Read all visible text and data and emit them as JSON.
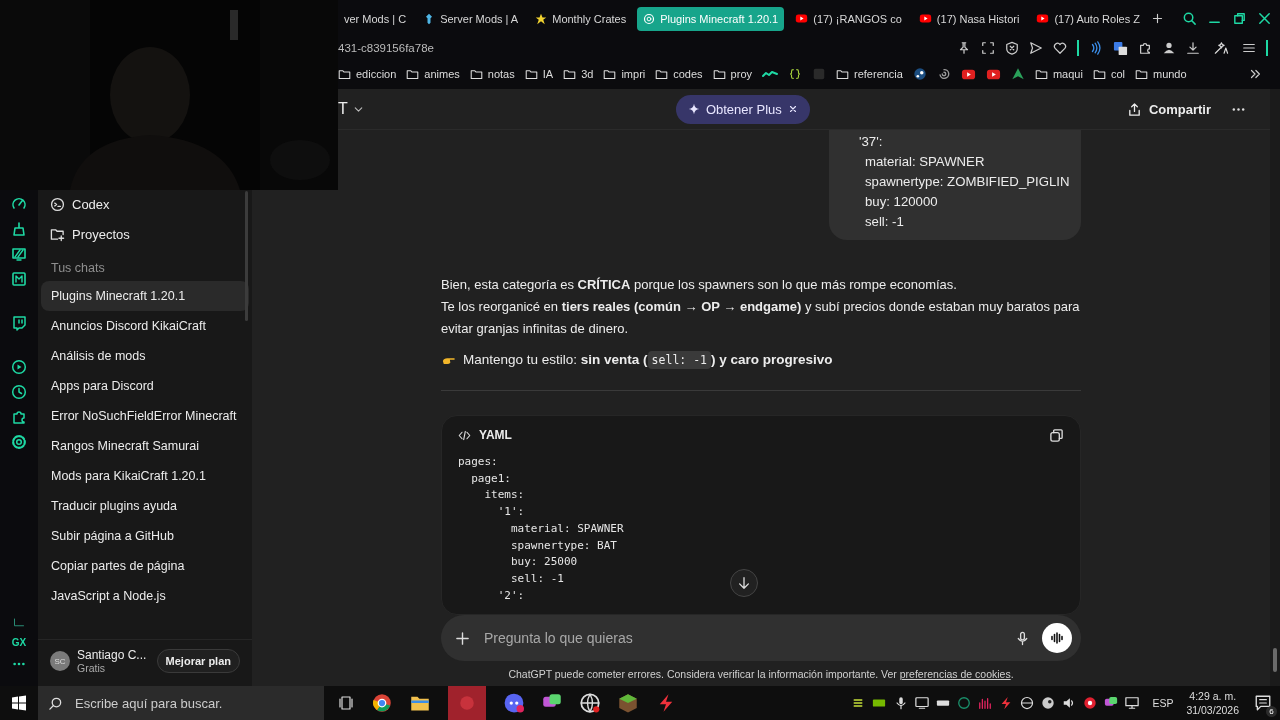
{
  "browser": {
    "tabs": [
      {
        "label": "ver Mods | C",
        "selected": false,
        "kind": "plain"
      },
      {
        "label": "Server Mods | A",
        "selected": false,
        "kind": "pin"
      },
      {
        "label": "Monthly Crates",
        "selected": false,
        "kind": "star"
      },
      {
        "label": "Plugins Minecraft 1.20.1",
        "selected": true,
        "kind": "chat"
      },
      {
        "label": "(17) ¡RANGOS co",
        "selected": false,
        "kind": "video"
      },
      {
        "label": "(17) Nasa Histori",
        "selected": false,
        "kind": "video"
      },
      {
        "label": "(17) Auto Roles Z",
        "selected": false,
        "kind": "video"
      }
    ],
    "address": "431-c839156fa78e",
    "bookmarks": [
      {
        "kind": "folder",
        "label": "ediccion"
      },
      {
        "kind": "folder",
        "label": "animes"
      },
      {
        "kind": "folder",
        "label": "notas"
      },
      {
        "kind": "folder",
        "label": "IA"
      },
      {
        "kind": "folder",
        "label": "3d"
      },
      {
        "kind": "folder",
        "label": "impri"
      },
      {
        "kind": "folder",
        "label": "codes"
      },
      {
        "kind": "folder",
        "label": "proy"
      },
      {
        "kind": "wave"
      },
      {
        "kind": "braces"
      },
      {
        "kind": "square"
      },
      {
        "kind": "folder",
        "label": "referencia"
      },
      {
        "kind": "steam"
      },
      {
        "kind": "swirl"
      },
      {
        "kind": "video"
      },
      {
        "kind": "video"
      },
      {
        "kind": "triangle"
      },
      {
        "kind": "folder",
        "label": "maqui"
      },
      {
        "kind": "folder",
        "label": "col"
      },
      {
        "kind": "folder",
        "label": "mundo"
      }
    ]
  },
  "gx_label": "GX",
  "chat_sidebar": {
    "nav": [
      {
        "label": "Codex",
        "kind": "codex"
      },
      {
        "label": "Proyectos",
        "kind": "projects"
      }
    ],
    "section": "Tus chats",
    "chats": [
      {
        "label": "Plugins Minecraft 1.20.1",
        "selected": true
      },
      {
        "label": "Anuncios Discord KikaiCraft",
        "selected": false
      },
      {
        "label": "Análisis de mods",
        "selected": false
      },
      {
        "label": "Apps para Discord",
        "selected": false
      },
      {
        "label": "Error NoSuchFieldError Minecraft",
        "selected": false
      },
      {
        "label": "Rangos Minecraft Samurai",
        "selected": false
      },
      {
        "label": "Mods para KikaiCraft 1.20.1",
        "selected": false
      },
      {
        "label": "Traducir plugins ayuda",
        "selected": false
      },
      {
        "label": "Subir página a GitHub",
        "selected": false
      },
      {
        "label": "Copiar partes de página",
        "selected": false
      },
      {
        "label": "JavaScript a Node.js",
        "selected": false
      }
    ],
    "user": {
      "initials": "SC",
      "name": "Santiago C...",
      "plan": "Gratis",
      "upgrade": "Mejorar plan"
    }
  },
  "header": {
    "title": "T",
    "plus": "Obtener Plus",
    "share": "Compartir"
  },
  "user_message": {
    "text": "'37':",
    "children": [
      {
        "text": "material: SPAWNER"
      },
      {
        "text": "spawnertype: ZOMBIFIED_PIGLIN"
      },
      {
        "text": "buy: 120000"
      },
      {
        "text": "sell: -1"
      }
    ]
  },
  "reply": {
    "paragraphs": [
      "Bien, esta categoría es **CRÍTICA** porque los spawners son lo que más rompe economías.",
      "Te los reorganicé en **tiers reales (común → OP → endgame)** y subí precios donde estaban muy baratos para evitar granjas infinitas de dinero."
    ],
    "tip": {
      "before": "Mantengo tu estilo: **sin venta (**",
      "code": "sell: -1",
      "after": "**) y caro progresivo**"
    }
  },
  "code_block": {
    "language": "YAML",
    "lines": [
      "pages:",
      "  page1:",
      "    items:",
      "      '1':",
      "        material: SPAWNER",
      "        spawnertype: BAT",
      "        buy: 25000",
      "        sell: -1",
      "      '2':"
    ]
  },
  "composer": {
    "placeholder": "Pregunta lo que quieras"
  },
  "footer": {
    "text": "ChatGPT puede cometer errores. Considera verificar la información importante. Ver ",
    "link": "preferencias de cookies",
    "end": "."
  },
  "taskbar": {
    "search": {
      "placeholder": "Escribe aquí para buscar."
    },
    "language": "ESP",
    "time": "4:29 a. m.",
    "date": "31/03/2026",
    "notifications": "6"
  }
}
